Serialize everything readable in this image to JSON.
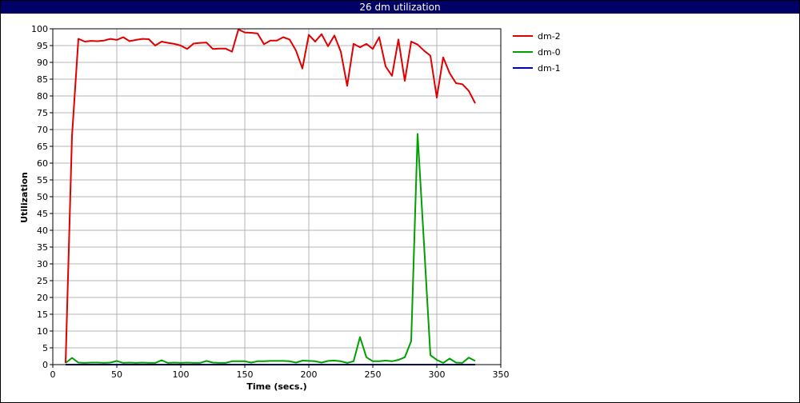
{
  "window": {
    "title": "26 dm utilization"
  },
  "colors": {
    "title_bar": "#000066",
    "grid": "#b4b4b4",
    "dm2": "#e00000",
    "dm0": "#00a000",
    "dm1": "#0000b0"
  },
  "chart_data": {
    "type": "line",
    "title": "26 dm utilization",
    "xlabel": "Time (secs.)",
    "ylabel": "Utilization",
    "xlim": [
      0,
      350
    ],
    "ylim": [
      0,
      100
    ],
    "xticks": [
      0,
      50,
      100,
      150,
      200,
      250,
      300,
      350
    ],
    "yticks": [
      0,
      5,
      10,
      15,
      20,
      25,
      30,
      35,
      40,
      45,
      50,
      55,
      60,
      65,
      70,
      75,
      80,
      85,
      90,
      95,
      100
    ],
    "grid": true,
    "legend_position": "right",
    "series": [
      {
        "name": "dm-2",
        "color": "#e00000",
        "points": [
          [
            10,
            0.5
          ],
          [
            15,
            68
          ],
          [
            20,
            97
          ],
          [
            25,
            96.2
          ],
          [
            30,
            96.4
          ],
          [
            35,
            96.3
          ],
          [
            40,
            96.5
          ],
          [
            45,
            97
          ],
          [
            50,
            96.7
          ],
          [
            55,
            97.5
          ],
          [
            60,
            96.3
          ],
          [
            65,
            96.7
          ],
          [
            70,
            97
          ],
          [
            75,
            96.9
          ],
          [
            80,
            95
          ],
          [
            85,
            96.2
          ],
          [
            90,
            95.8
          ],
          [
            95,
            95.5
          ],
          [
            100,
            95
          ],
          [
            105,
            94
          ],
          [
            110,
            95.6
          ],
          [
            115,
            95.8
          ],
          [
            120,
            95.9
          ],
          [
            125,
            94
          ],
          [
            130,
            94.1
          ],
          [
            135,
            94.1
          ],
          [
            140,
            93.2
          ],
          [
            145,
            99.8
          ],
          [
            150,
            98.9
          ],
          [
            155,
            98.8
          ],
          [
            160,
            98.6
          ],
          [
            165,
            95.4
          ],
          [
            170,
            96.5
          ],
          [
            175,
            96.5
          ],
          [
            180,
            97.5
          ],
          [
            185,
            96.8
          ],
          [
            190,
            93.5
          ],
          [
            195,
            88.2
          ],
          [
            200,
            98.2
          ],
          [
            205,
            96.2
          ],
          [
            210,
            98.4
          ],
          [
            215,
            94.8
          ],
          [
            220,
            98
          ],
          [
            225,
            93.2
          ],
          [
            230,
            83
          ],
          [
            235,
            95.5
          ],
          [
            240,
            94.5
          ],
          [
            245,
            95.5
          ],
          [
            250,
            94
          ],
          [
            255,
            97.5
          ],
          [
            260,
            88.8
          ],
          [
            265,
            86
          ],
          [
            270,
            96.8
          ],
          [
            275,
            84.5
          ],
          [
            280,
            96.2
          ],
          [
            285,
            95.3
          ],
          [
            290,
            93.5
          ],
          [
            295,
            92
          ],
          [
            300,
            79.5
          ],
          [
            305,
            91.5
          ],
          [
            310,
            86.8
          ],
          [
            315,
            83.8
          ],
          [
            320,
            83.5
          ],
          [
            325,
            81.5
          ],
          [
            330,
            77.8
          ]
        ]
      },
      {
        "name": "dm-0",
        "color": "#00a000",
        "points": [
          [
            10,
            0.5
          ],
          [
            15,
            2
          ],
          [
            20,
            0.6
          ],
          [
            25,
            0.5
          ],
          [
            30,
            0.6
          ],
          [
            35,
            0.6
          ],
          [
            40,
            0.5
          ],
          [
            45,
            0.6
          ],
          [
            50,
            1.1
          ],
          [
            55,
            0.5
          ],
          [
            60,
            0.6
          ],
          [
            65,
            0.5
          ],
          [
            70,
            0.6
          ],
          [
            75,
            0.5
          ],
          [
            80,
            0.5
          ],
          [
            85,
            1.3
          ],
          [
            90,
            0.5
          ],
          [
            95,
            0.6
          ],
          [
            100,
            0.5
          ],
          [
            105,
            0.6
          ],
          [
            110,
            0.5
          ],
          [
            115,
            0.5
          ],
          [
            120,
            1.1
          ],
          [
            125,
            0.6
          ],
          [
            130,
            0.5
          ],
          [
            135,
            0.5
          ],
          [
            140,
            1
          ],
          [
            145,
            1
          ],
          [
            150,
            1
          ],
          [
            155,
            0.6
          ],
          [
            160,
            1
          ],
          [
            165,
            1
          ],
          [
            170,
            1.1
          ],
          [
            175,
            1.1
          ],
          [
            180,
            1.1
          ],
          [
            185,
            1
          ],
          [
            190,
            0.6
          ],
          [
            195,
            1.2
          ],
          [
            200,
            1.1
          ],
          [
            205,
            1
          ],
          [
            210,
            0.6
          ],
          [
            215,
            1.1
          ],
          [
            220,
            1.2
          ],
          [
            225,
            1
          ],
          [
            230,
            0.5
          ],
          [
            235,
            1
          ],
          [
            240,
            8.2
          ],
          [
            245,
            2.2
          ],
          [
            250,
            1
          ],
          [
            255,
            1
          ],
          [
            260,
            1.2
          ],
          [
            265,
            1
          ],
          [
            270,
            1.4
          ],
          [
            275,
            2.2
          ],
          [
            280,
            7
          ],
          [
            285,
            68.7
          ],
          [
            290,
            36
          ],
          [
            295,
            2.8
          ],
          [
            300,
            1.4
          ],
          [
            305,
            0.5
          ],
          [
            310,
            1.8
          ],
          [
            315,
            0.6
          ],
          [
            320,
            0.5
          ],
          [
            325,
            2.1
          ],
          [
            330,
            1.1
          ]
        ]
      },
      {
        "name": "dm-1",
        "color": "#0000b0",
        "points": [
          [
            10,
            0
          ],
          [
            50,
            0
          ],
          [
            100,
            0
          ],
          [
            150,
            0
          ],
          [
            200,
            0
          ],
          [
            250,
            0
          ],
          [
            300,
            0
          ],
          [
            330,
            0
          ]
        ]
      }
    ]
  }
}
